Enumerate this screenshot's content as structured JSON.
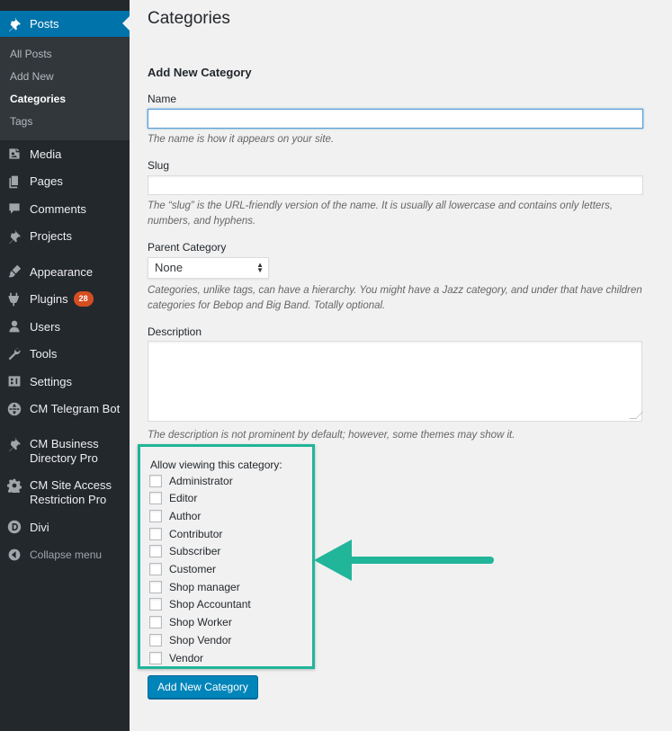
{
  "sidebar": {
    "posts_label": "Posts",
    "submenu": [
      "All Posts",
      "Add New",
      "Categories",
      "Tags"
    ],
    "items": [
      {
        "label": "Media",
        "icon": "media-icon"
      },
      {
        "label": "Pages",
        "icon": "pages-icon"
      },
      {
        "label": "Comments",
        "icon": "comments-icon"
      },
      {
        "label": "Projects",
        "icon": "pin-icon"
      },
      {
        "label": "Appearance",
        "icon": "paintbrush-icon"
      },
      {
        "label": "Plugins",
        "icon": "plugin-icon",
        "badge": "28"
      },
      {
        "label": "Users",
        "icon": "users-icon"
      },
      {
        "label": "Tools",
        "icon": "wrench-icon"
      },
      {
        "label": "Settings",
        "icon": "settings-icon"
      },
      {
        "label": "CM Telegram Bot",
        "icon": "globe-icon"
      },
      {
        "label": "CM Business Directory Pro",
        "icon": "pin-icon"
      },
      {
        "label": "CM Site Access Restriction Pro",
        "icon": "gear-icon"
      },
      {
        "label": "Divi",
        "icon": "divi-icon"
      }
    ],
    "collapse_label": "Collapse menu"
  },
  "main": {
    "page_title": "Categories",
    "section_title": "Add New Category",
    "name_label": "Name",
    "name_value": "",
    "name_hint": "The name is how it appears on your site.",
    "slug_label": "Slug",
    "slug_value": "",
    "slug_hint": "The “slug” is the URL-friendly version of the name. It is usually all lowercase and contains only letters, numbers, and hyphens.",
    "parent_label": "Parent Category",
    "parent_value": "None",
    "parent_hint": "Categories, unlike tags, can have a hierarchy. You might have a Jazz category, and under that have children categories for Bebop and Big Band. Totally optional.",
    "description_label": "Description",
    "description_hint": "The description is not prominent by default; however, some themes may show it.",
    "permissions_title": "Allow viewing this category:",
    "roles": [
      "Administrator",
      "Editor",
      "Author",
      "Contributor",
      "Subscriber",
      "Customer",
      "Shop manager",
      "Shop Accountant",
      "Shop Worker",
      "Shop Vendor",
      "Vendor"
    ],
    "submit_label": "Add New Category"
  },
  "colors": {
    "sidebar_bg": "#23282d",
    "accent": "#0073aa",
    "highlight_box": "#21b59a",
    "badge": "#d54e21"
  }
}
